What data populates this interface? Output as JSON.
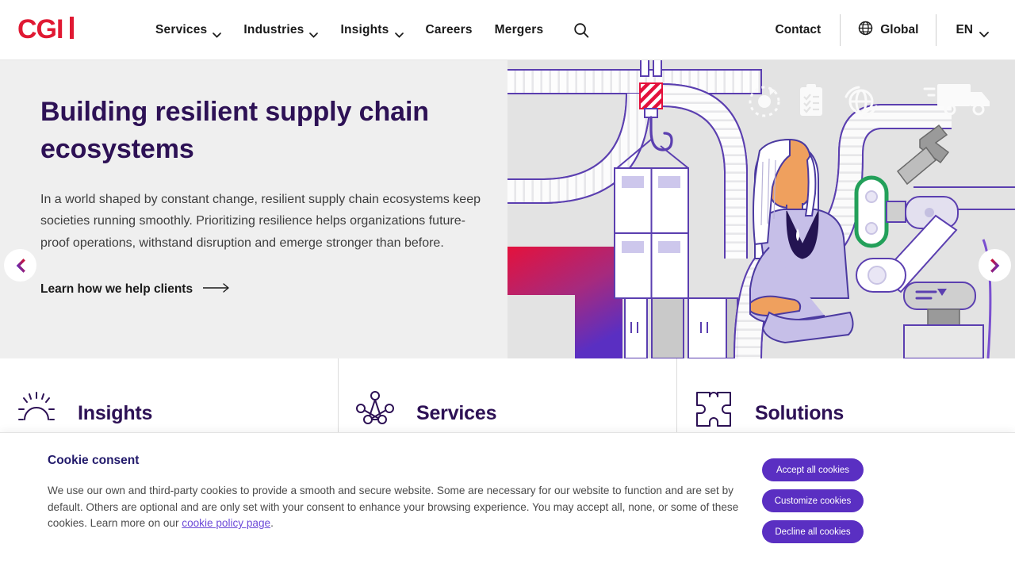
{
  "brand": {
    "logo_text": "CGI",
    "logo_color": "#e01933"
  },
  "nav": {
    "items": [
      {
        "label": "Services",
        "has_chevron": true
      },
      {
        "label": "Industries",
        "has_chevron": true
      },
      {
        "label": "Insights",
        "has_chevron": true
      },
      {
        "label": "Careers",
        "has_chevron": false
      },
      {
        "label": "Mergers",
        "has_chevron": false
      }
    ],
    "search_icon": "search-icon",
    "contact_label": "Contact",
    "global_label": "Global",
    "global_icon": "globe-icon",
    "language_label": "EN",
    "language_chevron_icon": "chevron-down-icon"
  },
  "hero": {
    "heading": "Building resilient supply chain ecosystems",
    "paragraph": "In a world shaped by constant change, resilient supply chain ecosystems keep societies running smoothly. Prioritizing resilience helps organizations future-proof operations, withstand disruption and emerge stronger than before.",
    "cta_label": "Learn how we help clients",
    "cta_arrow_icon": "arrow-right-icon",
    "prev_icon": "carousel-prev-icon",
    "next_icon": "carousel-next-icon",
    "background_color": "#efefef",
    "heading_color": "#2d1155",
    "illustration_alt": "supply-chain-illustration"
  },
  "cards": [
    {
      "title": "Insights",
      "icon": "sunrise-icon"
    },
    {
      "title": "Services",
      "icon": "network-nodes-icon"
    },
    {
      "title": "Solutions",
      "icon": "puzzle-piece-icon"
    }
  ],
  "cookie": {
    "heading": "Cookie consent",
    "body_before_link": "We use our own and third-party cookies to provide a smooth and secure website. Some are necessary for our website to function and are set by default. Others are optional and are only set with your consent to enhance your browsing experience. You may accept all, none, or some of these cookies. Learn more on our ",
    "link_label": "cookie policy page",
    "body_after_link": ".",
    "buttons": [
      {
        "label": "Accept all cookies"
      },
      {
        "label": "Customize cookies"
      },
      {
        "label": "Decline all cookies"
      }
    ],
    "button_color": "#5a2fc2"
  }
}
